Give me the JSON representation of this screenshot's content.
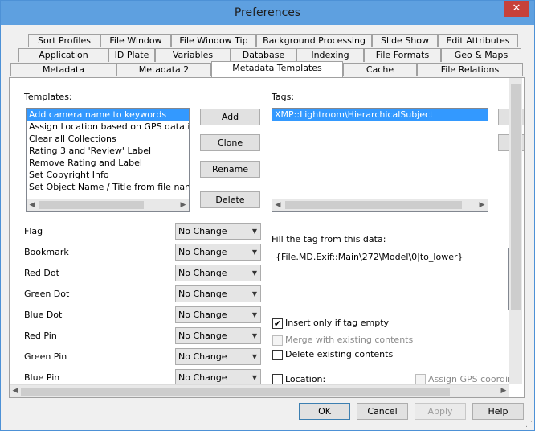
{
  "window": {
    "title": "Preferences",
    "close_glyph": "✕"
  },
  "tabs": {
    "row1": [
      "Sort Profiles",
      "File Window",
      "File Window Tip",
      "Background Processing",
      "Slide Show",
      "Edit Attributes"
    ],
    "row2": [
      "Application",
      "ID Plate",
      "Variables",
      "Database",
      "Indexing",
      "File Formats",
      "Geo & Maps"
    ],
    "row3": [
      "Metadata",
      "Metadata 2",
      "Metadata Templates",
      "Cache",
      "File Relations"
    ],
    "active": "Metadata Templates"
  },
  "templates": {
    "label": "Templates:",
    "items": [
      "Add camera name to keywords",
      "Assign Location based on GPS data in",
      "Clear all Collections",
      "Rating 3 and 'Review' Label",
      "Remove Rating and Label",
      "Set Copyright Info",
      "Set Object Name / Title from file nam"
    ],
    "selected_index": 0
  },
  "template_buttons": {
    "add": "Add",
    "clone": "Clone",
    "rename": "Rename",
    "delete": "Delete"
  },
  "tags": {
    "label": "Tags:",
    "items": [
      "XMP::Lightroom\\HierarchicalSubject"
    ],
    "selected_index": 0
  },
  "attributes": [
    {
      "label": "Flag",
      "value": "No Change"
    },
    {
      "label": "Bookmark",
      "value": "No Change"
    },
    {
      "label": "Red Dot",
      "value": "No Change"
    },
    {
      "label": "Green Dot",
      "value": "No Change"
    },
    {
      "label": "Blue Dot",
      "value": "No Change"
    },
    {
      "label": "Red Pin",
      "value": "No Change"
    },
    {
      "label": "Green Pin",
      "value": "No Change"
    },
    {
      "label": "Blue Pin",
      "value": "No Change"
    }
  ],
  "fill": {
    "label": "Fill the tag from this data:",
    "value": "{File.MD.Exif::Main\\272\\Model\\0|to_lower}"
  },
  "options": {
    "insert_only": {
      "label": "Insert only if tag empty",
      "checked": true
    },
    "merge": {
      "label": "Merge with existing contents",
      "checked": false,
      "disabled": true
    },
    "delete_existing": {
      "label": "Delete existing contents",
      "checked": false
    },
    "location": {
      "label": "Location:",
      "checked": false
    },
    "assign_gps": {
      "label": "Assign GPS coordinat",
      "checked": false,
      "disabled": true
    }
  },
  "dialog_buttons": {
    "ok": "OK",
    "cancel": "Cancel",
    "apply": "Apply",
    "help": "Help"
  },
  "colors": {
    "selection": "#3399ff",
    "title_bar": "#5ea0e0",
    "close": "#c7413a"
  }
}
